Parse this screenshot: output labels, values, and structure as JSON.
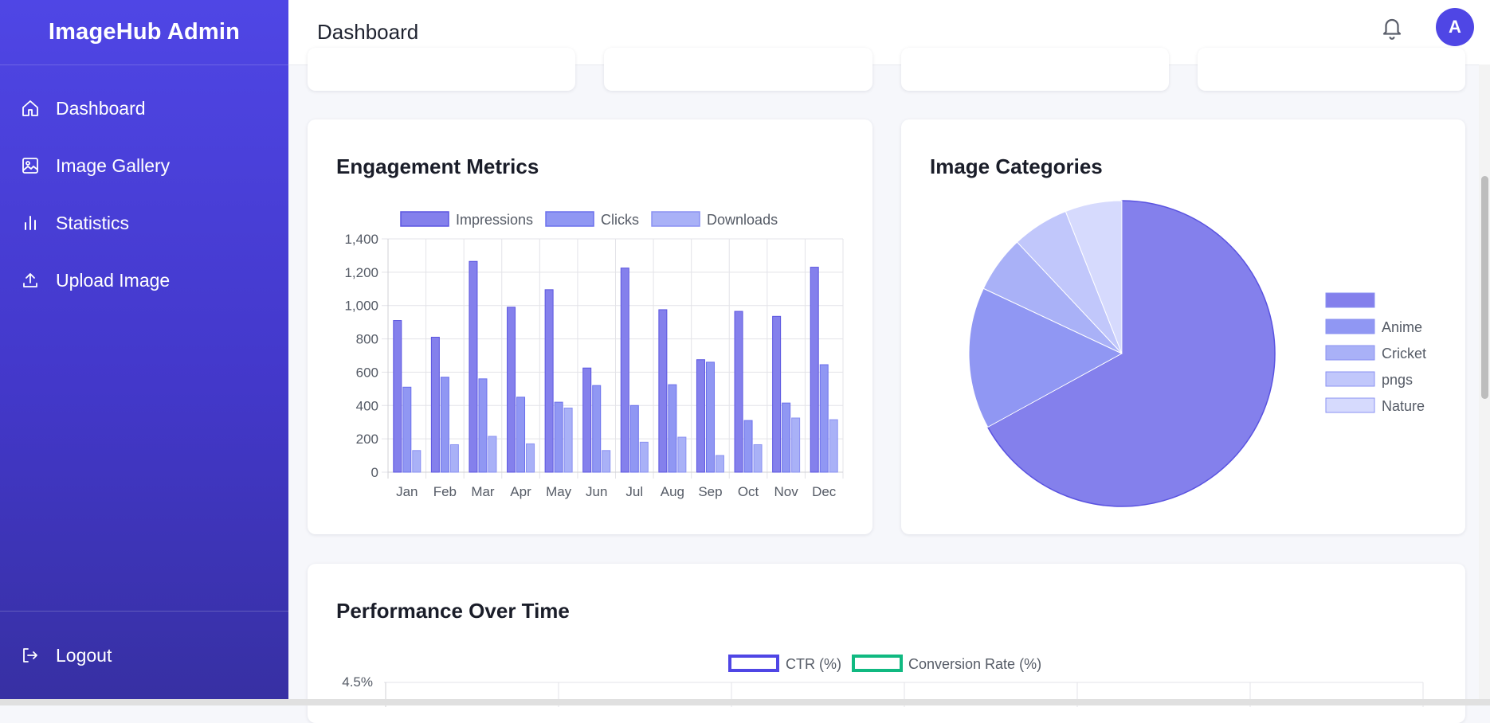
{
  "sidebar": {
    "brand": "ImageHub Admin",
    "items": [
      {
        "label": "Dashboard",
        "icon": "home-icon"
      },
      {
        "label": "Image Gallery",
        "icon": "image-icon"
      },
      {
        "label": "Statistics",
        "icon": "bar-chart-icon"
      },
      {
        "label": "Upload Image",
        "icon": "upload-icon"
      }
    ],
    "logout": "Logout"
  },
  "header": {
    "title": "Dashboard",
    "avatar_initial": "A"
  },
  "colors": {
    "primary": "#4f46e5",
    "impressions": "#8480ec",
    "clicks": "#9097f3",
    "downloads": "#a9b1f7",
    "ctr": "#4f46e5",
    "conversion": "#10b981"
  },
  "engagement": {
    "title": "Engagement Metrics",
    "chart_data": {
      "type": "bar",
      "categories": [
        "Jan",
        "Feb",
        "Mar",
        "Apr",
        "May",
        "Jun",
        "Jul",
        "Aug",
        "Sep",
        "Oct",
        "Nov",
        "Dec"
      ],
      "series": [
        {
          "name": "Impressions",
          "values": [
            910,
            810,
            1265,
            990,
            1095,
            625,
            1225,
            975,
            675,
            965,
            935,
            1230
          ]
        },
        {
          "name": "Clicks",
          "values": [
            510,
            570,
            560,
            450,
            420,
            520,
            400,
            525,
            660,
            310,
            415,
            645
          ]
        },
        {
          "name": "Downloads",
          "values": [
            130,
            165,
            215,
            170,
            385,
            130,
            180,
            210,
            100,
            165,
            325,
            315
          ]
        }
      ],
      "yticks": [
        "0",
        "200",
        "400",
        "600",
        "800",
        "1,000",
        "1,200",
        "1,400"
      ],
      "ylim": [
        0,
        1400
      ],
      "grid": true,
      "legend": "top"
    }
  },
  "categories": {
    "title": "Image Categories",
    "chart_data": {
      "type": "pie",
      "labels": [
        "",
        "Anime",
        "Cricket",
        "pngs",
        "Nature"
      ],
      "values": [
        67,
        15,
        6,
        6,
        6
      ],
      "colors": [
        "#8480ec",
        "#9097f3",
        "#a9b1f7",
        "#c1c7fb",
        "#d6dafd"
      ],
      "legend": "right"
    }
  },
  "performance": {
    "title": "Performance Over Time",
    "legend": [
      "CTR (%)",
      "Conversion Rate (%)"
    ],
    "top_tick": "4.5%"
  }
}
